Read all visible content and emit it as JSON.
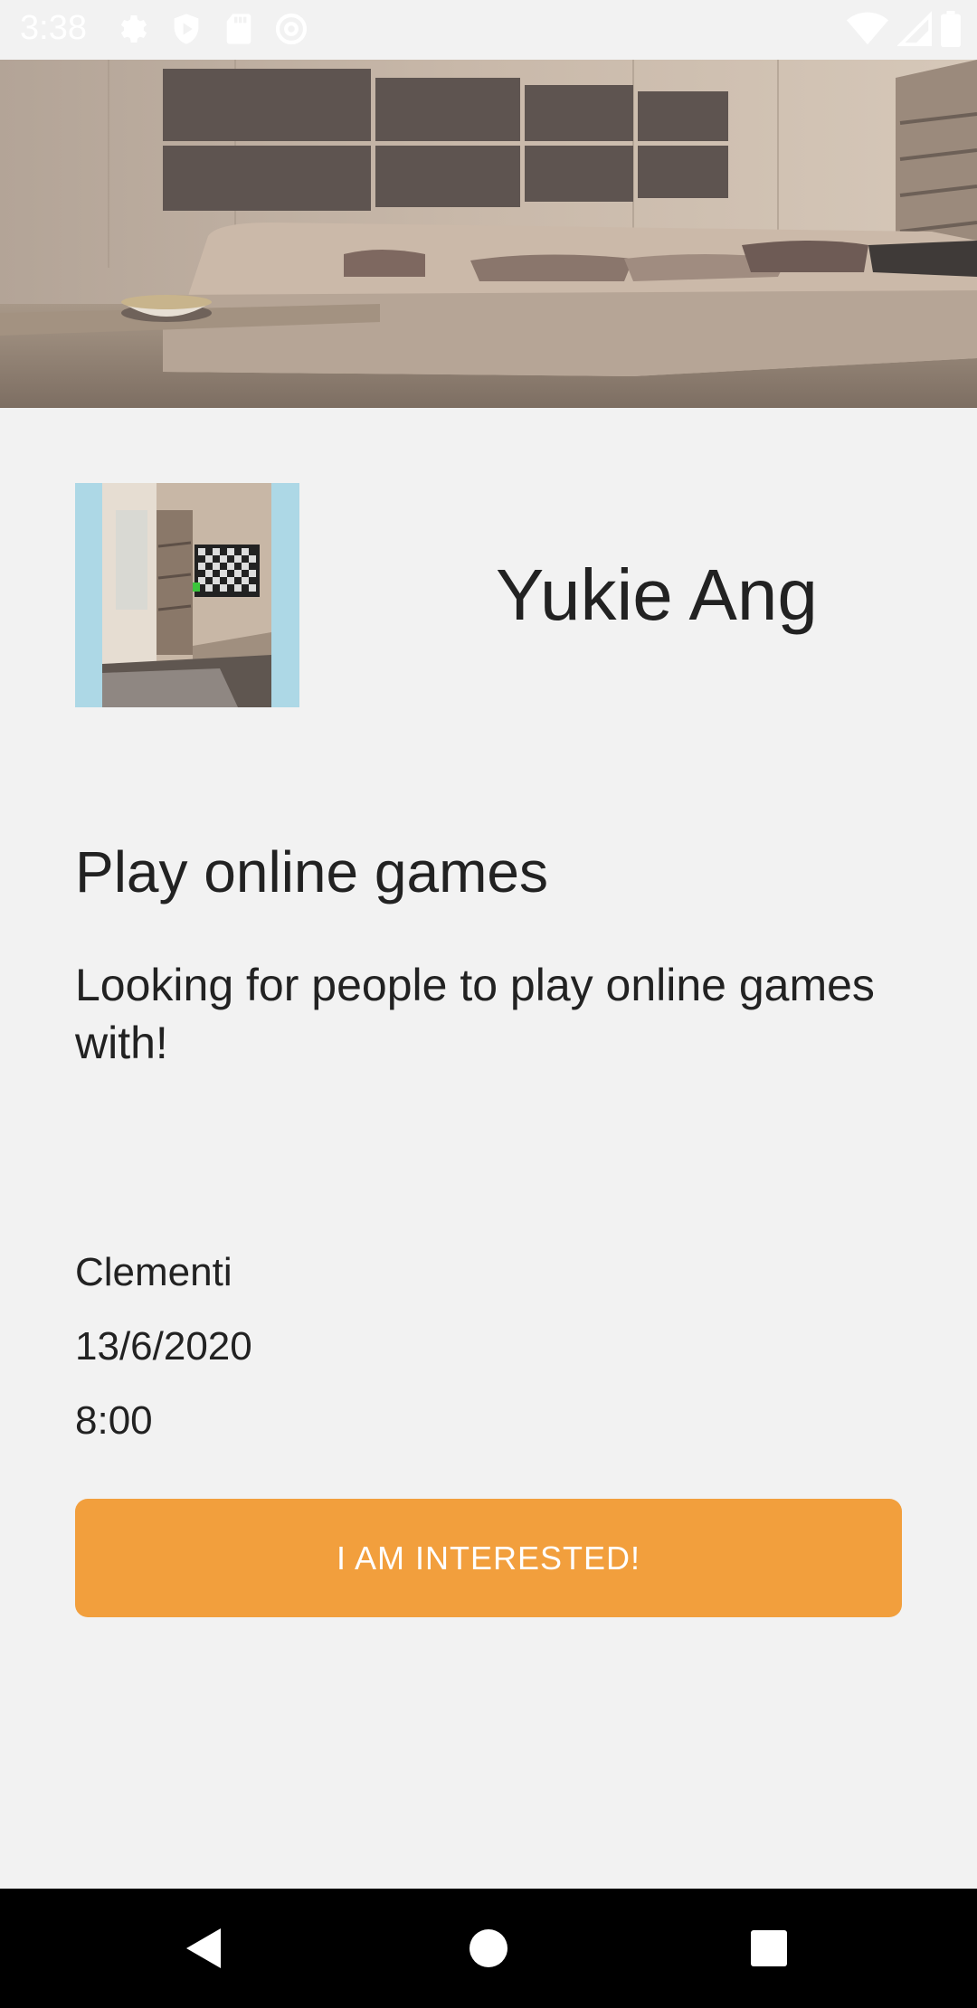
{
  "status_bar": {
    "time": "3:38",
    "icons": [
      "settings-icon",
      "shield-icon",
      "sd-card-icon",
      "at-sign-icon"
    ],
    "right_icons": [
      "wifi-icon",
      "signal-icon",
      "battery-icon"
    ]
  },
  "hero": {
    "image": "living-room-photo"
  },
  "profile": {
    "avatar_image": "room-with-tv-photo",
    "name": "Yukie Ang"
  },
  "activity": {
    "title": "Play online games",
    "description": "Looking for people to play online games with!",
    "location": "Clementi",
    "date": "13/6/2020",
    "time": "8:00"
  },
  "action": {
    "interest_label": "I AM INTERESTED!",
    "accent_color": "#f29f3d"
  },
  "nav_bar": {
    "buttons": [
      "back-icon",
      "home-icon",
      "recent-apps-icon"
    ]
  }
}
